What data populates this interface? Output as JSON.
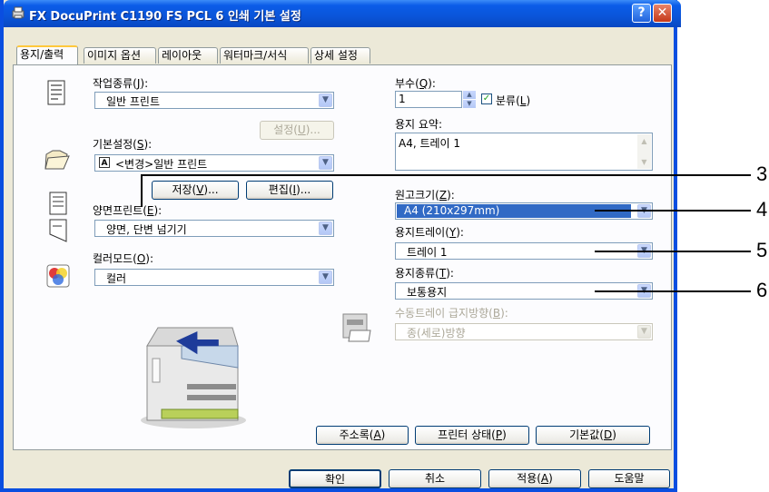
{
  "window": {
    "title": "FX DocuPrint C1190 FS PCL 6 인쇄 기본 설정",
    "help_glyph": "?",
    "close_glyph": "✕"
  },
  "tabs": [
    {
      "label": "용지/출력",
      "active": true
    },
    {
      "label": "이미지 옵션"
    },
    {
      "label": "레이아웃"
    },
    {
      "label": "워터마크/서식"
    },
    {
      "label": "상세 설정"
    }
  ],
  "left": {
    "job_type": {
      "label_pre": "작업종류(",
      "key": "J",
      "label_post": "):",
      "value": "일반 프린트"
    },
    "settings_button": {
      "pre": "설정(",
      "key": "U",
      "post": ")..."
    },
    "preset": {
      "label_pre": "기본설정(",
      "key": "S",
      "label_post": "):",
      "badge": "A",
      "value": "<변경>일반 프린트"
    },
    "save_button": {
      "pre": "저장(",
      "key": "V",
      "post": ")..."
    },
    "edit_button": {
      "pre": "편집(",
      "key": "I",
      "post": ")..."
    },
    "duplex": {
      "label_pre": "양면프린트(",
      "key": "E",
      "label_post": "):",
      "value": "양면, 단변 넘기기"
    },
    "color_mode": {
      "label_pre": "컬러모드(",
      "key": "O",
      "label_post": "):",
      "value": "컬러"
    }
  },
  "right": {
    "copies": {
      "label_pre": "부수(",
      "key": "Q",
      "label_post": "):",
      "value": "1"
    },
    "collate": {
      "label_pre": "분류(",
      "key": "L",
      "label_post": ")",
      "checked": true
    },
    "summary": {
      "label": "용지 요약:",
      "value": "A4, 트레이 1"
    },
    "original_size": {
      "label_pre": "원고크기(",
      "key": "Z",
      "label_post": "):",
      "value": "A4 (210x297mm)"
    },
    "paper_tray": {
      "label_pre": "용지트레이(",
      "key": "Y",
      "label_post": "):",
      "value": "트레이 1"
    },
    "paper_type": {
      "label_pre": "용지종류(",
      "key": "T",
      "label_post": "):",
      "value": "보통용지"
    },
    "bypass_orientation": {
      "label_pre": "수동트레이 급지방향(",
      "key": "B",
      "label_post": "):",
      "value": "종(세로)방향"
    }
  },
  "panel_buttons": {
    "address_book": {
      "pre": "주소록(",
      "key": "A",
      "post": ")"
    },
    "printer_status": {
      "pre": "프린터 상태(",
      "key": "P",
      "post": ")"
    },
    "defaults": {
      "pre": "기본값(",
      "key": "D",
      "post": ")"
    }
  },
  "dialog_buttons": {
    "ok": "확인",
    "cancel": "취소",
    "apply": {
      "pre": "적용(",
      "key": "A",
      "post": ")"
    },
    "help": "도움말"
  },
  "callouts": [
    "3",
    "4",
    "5",
    "6"
  ],
  "colors": {
    "titlebar": "#0a55d9",
    "highlight": "#316ac5",
    "dialog_bg": "#ece9d8",
    "panel_bg": "#fcfcfe"
  }
}
